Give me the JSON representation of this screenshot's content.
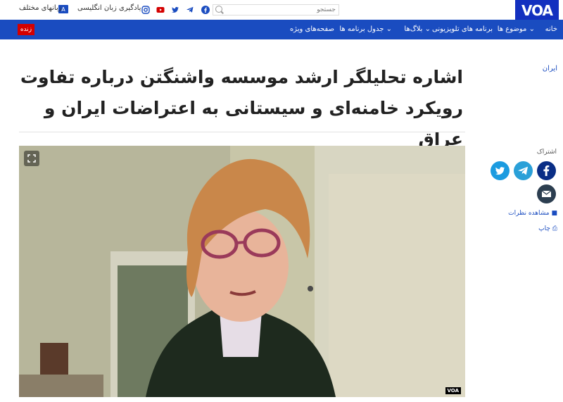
{
  "topbar": {
    "logo": "VOA",
    "search_placeholder": "جستجو",
    "learn_english": "یادگیری زبان انگلیسی",
    "languages": "زبانهای مختلف"
  },
  "nav": {
    "home": "خانه",
    "topics": "موضوع ها",
    "tv_programs": "برنامه های تلویزیونی",
    "blogs": "بلاگ‌ها",
    "schedule": "جدول برنامه ها",
    "special_pages": "صفحه‌های ویژه",
    "live": "زنده"
  },
  "article": {
    "section": "ایران",
    "title": "اشاره تحلیلگر ارشد موسسه واشنگتن درباره تفاوت رویکرد خامنه‌ای و سیستانی به اعتراضات ایران و عراق",
    "video_watermark": "VOA"
  },
  "sidebar": {
    "share_label": "اشتراک",
    "comments": "مشاهده نظرات",
    "print": "چاپ"
  },
  "colors": {
    "brand": "#1a4cc0",
    "logo": "#1330bf",
    "live": "#d40000",
    "twitter": "#1b9be0",
    "telegram": "#2aa0d8",
    "facebook": "#0a2e86",
    "email": "#2c3e50"
  }
}
